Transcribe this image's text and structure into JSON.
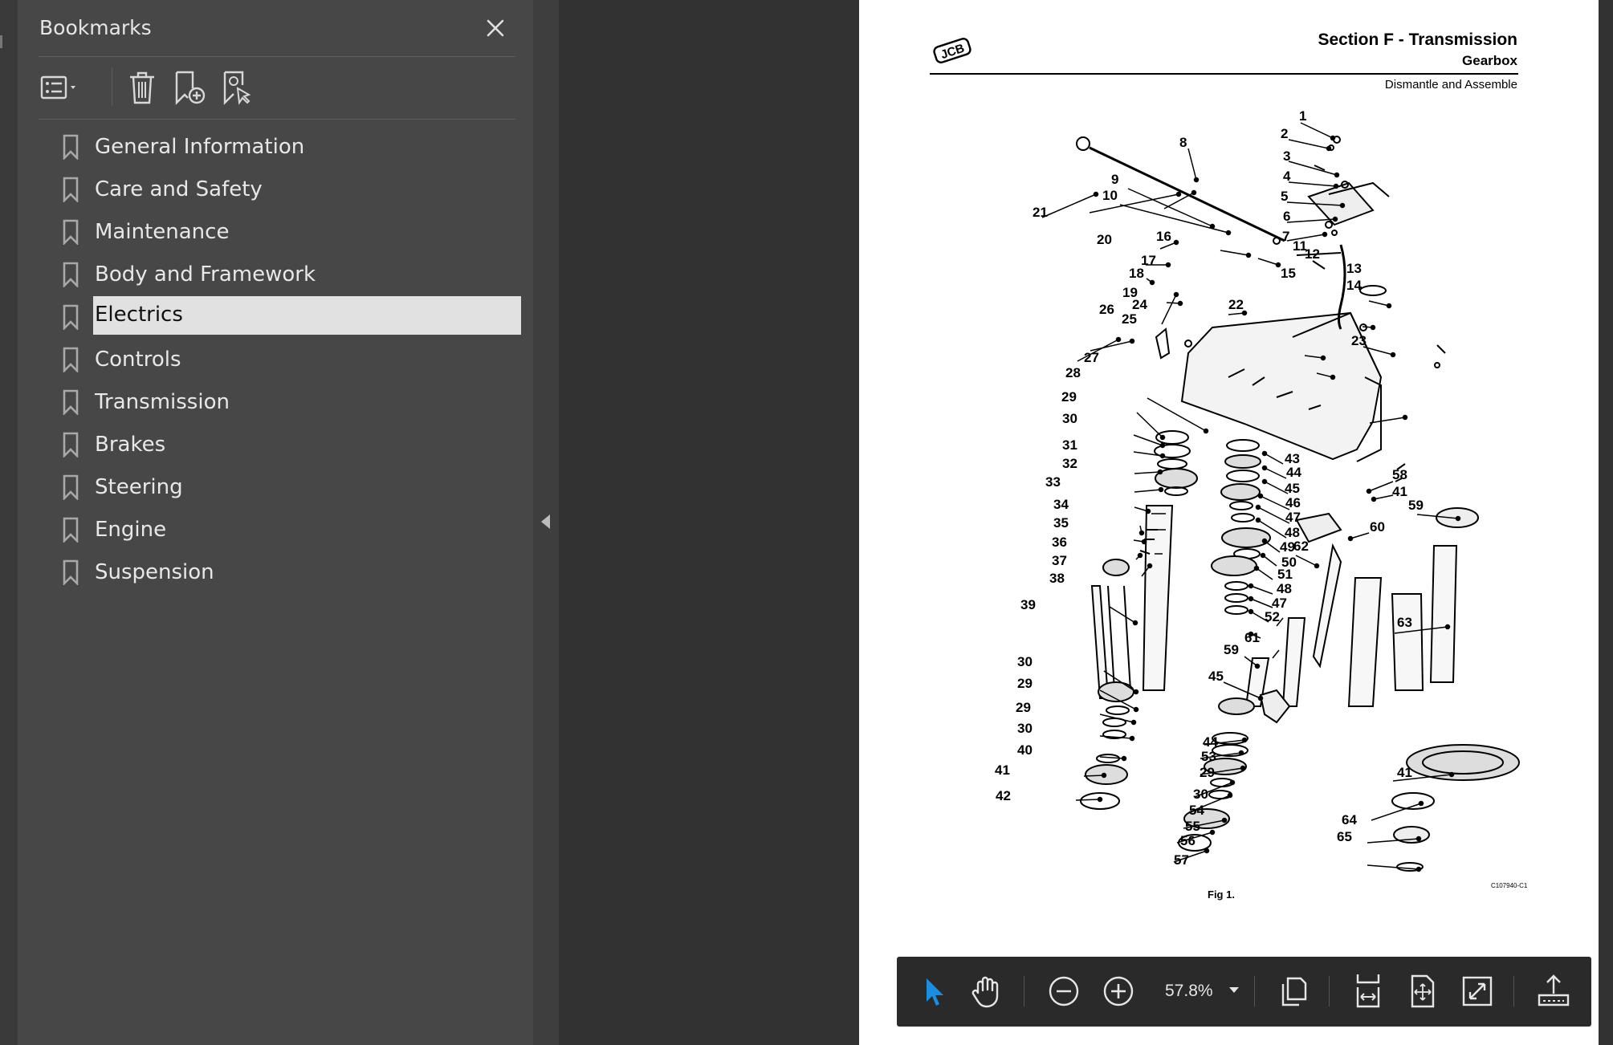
{
  "bookmarks_panel": {
    "title": "Bookmarks",
    "tools": [
      "options-icon",
      "delete-icon",
      "add-bookmark-icon",
      "bookmark-select-icon"
    ],
    "items": [
      {
        "label": "General Information"
      },
      {
        "label": "Care and Safety"
      },
      {
        "label": "Maintenance"
      },
      {
        "label": "Body and Framework"
      },
      {
        "label": "Electrics",
        "selected": true
      },
      {
        "label": "Controls"
      },
      {
        "label": "Transmission"
      },
      {
        "label": "Brakes"
      },
      {
        "label": "Steering"
      },
      {
        "label": "Engine"
      },
      {
        "label": "Suspension"
      }
    ]
  },
  "page": {
    "logo": "JCB",
    "section_title": "Section F - Transmission",
    "subsection": "Gearbox",
    "subsubsection": "Dismantle and Assemble",
    "figure_caption": "Fig 1.",
    "figure_code": "C107940-C1",
    "callouts": [
      "1",
      "2",
      "3",
      "4",
      "5",
      "6",
      "7",
      "8",
      "9",
      "10",
      "11",
      "12",
      "13",
      "14",
      "15",
      "16",
      "17",
      "18",
      "19",
      "20",
      "21",
      "22",
      "23",
      "24",
      "25",
      "26",
      "27",
      "28",
      "29",
      "30",
      "31",
      "32",
      "33",
      "34",
      "35",
      "36",
      "37",
      "38",
      "39",
      "30",
      "29",
      "29",
      "30",
      "40",
      "41",
      "42",
      "43",
      "44",
      "45",
      "46",
      "47",
      "48",
      "49",
      "50",
      "51",
      "48",
      "47",
      "52",
      "61",
      "59",
      "45",
      "44",
      "53",
      "29",
      "30",
      "54",
      "55",
      "56",
      "57",
      "58",
      "41",
      "59",
      "60",
      "62",
      "63",
      "41",
      "64",
      "65"
    ]
  },
  "toolbar": {
    "zoom_value": "57.8%",
    "tools": [
      "select-icon",
      "hand-icon",
      "zoom-out-icon",
      "zoom-in-icon",
      "page-view-icon",
      "fit-width-icon",
      "fit-page-icon",
      "fullscreen-icon",
      "share-icon"
    ]
  },
  "colors": {
    "accent": "#1a8fe0",
    "panel": "#474747",
    "canvas": "#323232",
    "selected": "#e1e1e1"
  }
}
